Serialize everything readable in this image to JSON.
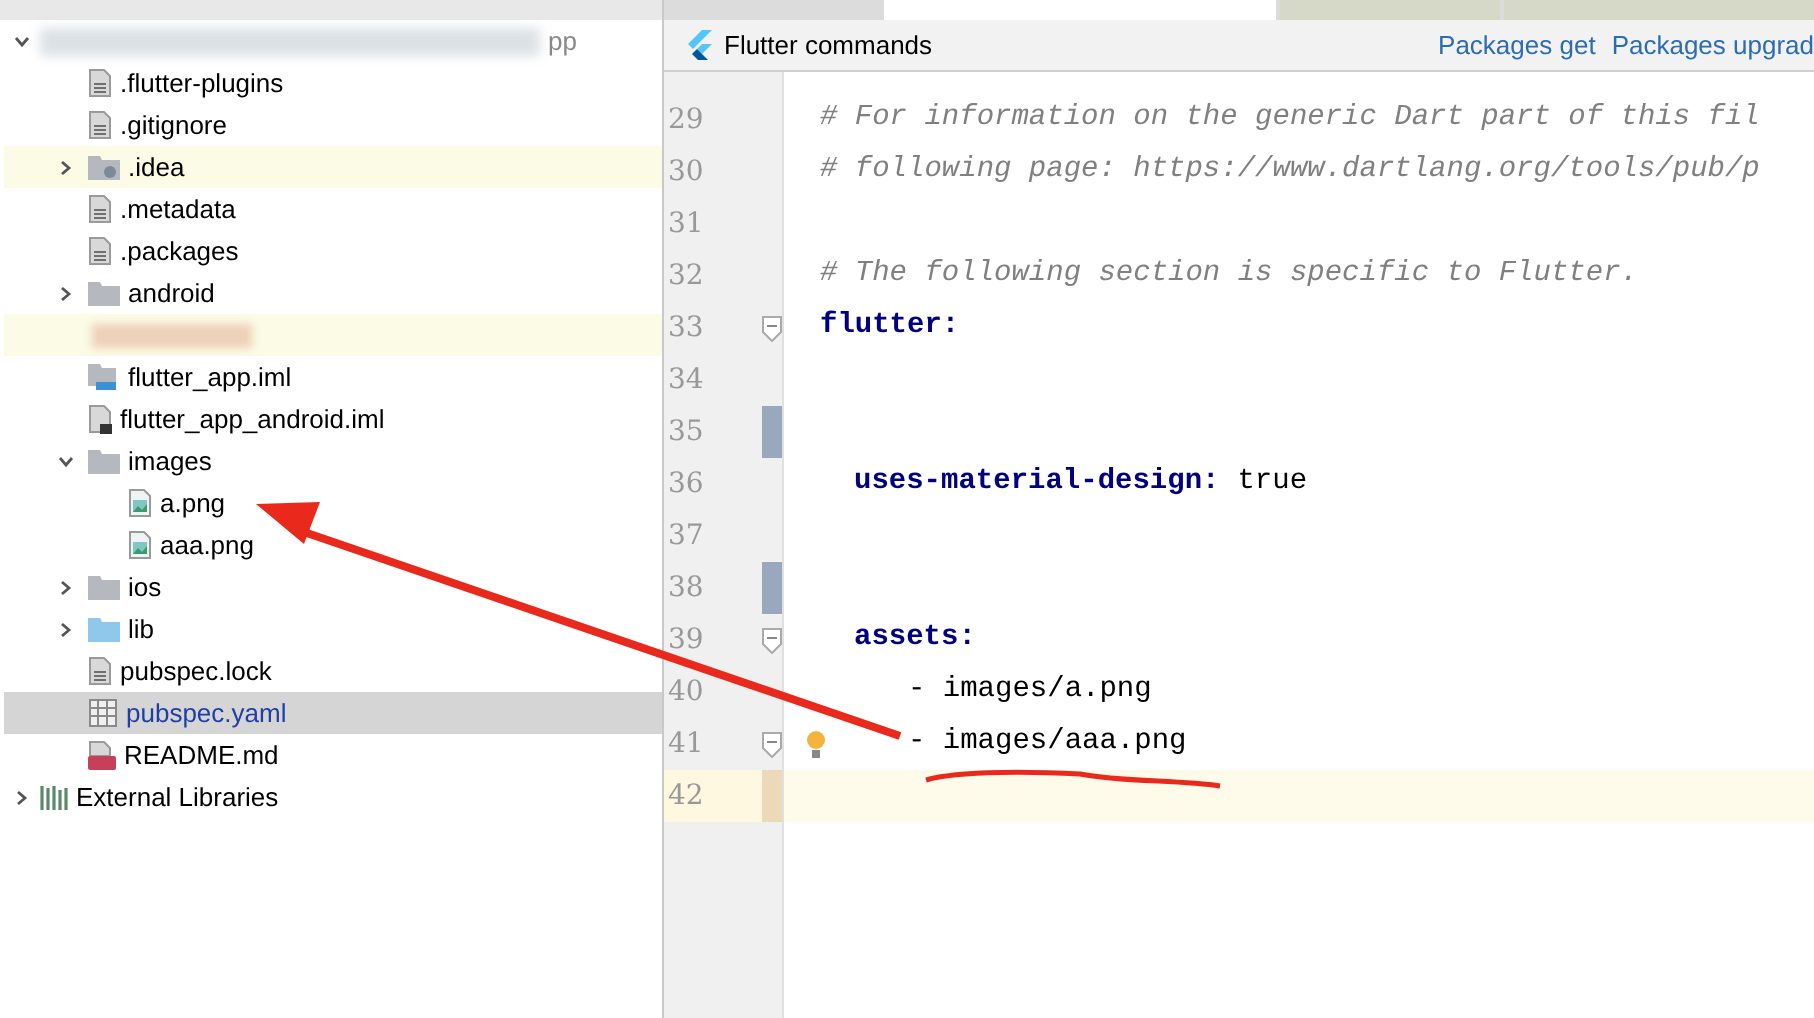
{
  "project_tree": {
    "root": {
      "label": "pp",
      "expanded": true
    },
    "items": [
      {
        "label": ".flutter-plugins",
        "kind": "file",
        "highlighted": false,
        "selected": false
      },
      {
        "label": ".gitignore",
        "kind": "file",
        "highlighted": false,
        "selected": false
      },
      {
        "label": ".idea",
        "kind": "folder_config",
        "expanded": false,
        "highlighted": true,
        "selected": false
      },
      {
        "label": ".metadata",
        "kind": "file",
        "highlighted": false,
        "selected": false
      },
      {
        "label": ".packages",
        "kind": "file",
        "highlighted": false,
        "selected": false
      },
      {
        "label": "android",
        "kind": "folder",
        "expanded": false,
        "highlighted": false,
        "selected": false
      },
      {
        "kind": "redacted",
        "highlighted": true,
        "selected": false
      },
      {
        "label": "flutter_app.iml",
        "kind": "module",
        "highlighted": false,
        "selected": false
      },
      {
        "label": "flutter_app_android.iml",
        "kind": "module_file",
        "highlighted": false,
        "selected": false
      },
      {
        "label": "images",
        "kind": "folder",
        "expanded": true,
        "highlighted": false,
        "selected": false,
        "children": [
          {
            "label": "a.png",
            "kind": "image",
            "highlighted": false,
            "selected": false
          },
          {
            "label": "aaa.png",
            "kind": "image",
            "highlighted": false,
            "selected": false
          }
        ]
      },
      {
        "label": "ios",
        "kind": "folder",
        "expanded": false,
        "highlighted": false,
        "selected": false
      },
      {
        "label": "lib",
        "kind": "folder_source",
        "expanded": false,
        "highlighted": false,
        "selected": false
      },
      {
        "label": "pubspec.lock",
        "kind": "file",
        "highlighted": false,
        "selected": false
      },
      {
        "label": "pubspec.yaml",
        "kind": "yaml",
        "selected": true
      },
      {
        "label": "README.md",
        "kind": "markdown",
        "highlighted": false,
        "selected": false
      }
    ],
    "external": {
      "label": "External Libraries",
      "expanded": false
    }
  },
  "editor": {
    "toolbar": {
      "title": "Flutter commands",
      "links": [
        "Packages get",
        "Packages upgrad"
      ]
    },
    "lines": [
      {
        "number": "29",
        "kind": "comment",
        "text": "# For information on the generic Dart part of this fil"
      },
      {
        "number": "30",
        "kind": "comment",
        "text": "# following page: https://www.dartlang.org/tools/pub/p"
      },
      {
        "number": "31",
        "kind": "blank"
      },
      {
        "number": "32",
        "kind": "comment",
        "text": "# The following section is specific to Flutter."
      },
      {
        "number": "33",
        "kind": "key",
        "text": "flutter:",
        "fold": true
      },
      {
        "number": "34",
        "kind": "blank"
      },
      {
        "number": "35",
        "kind": "blank",
        "changed": true
      },
      {
        "number": "36",
        "kind": "key_value",
        "key": "uses-material-design:",
        "value": "true"
      },
      {
        "number": "37",
        "kind": "blank"
      },
      {
        "number": "38",
        "kind": "blank",
        "changed": true
      },
      {
        "number": "39",
        "kind": "key",
        "text": "assets:",
        "indent": true,
        "fold": true
      },
      {
        "number": "40",
        "kind": "list_item",
        "text": "- images/a.png"
      },
      {
        "number": "41",
        "kind": "list_item",
        "text": "- images/aaa.png",
        "fold": true,
        "bulb": true
      },
      {
        "number": "42",
        "kind": "blank",
        "current": true
      }
    ]
  }
}
